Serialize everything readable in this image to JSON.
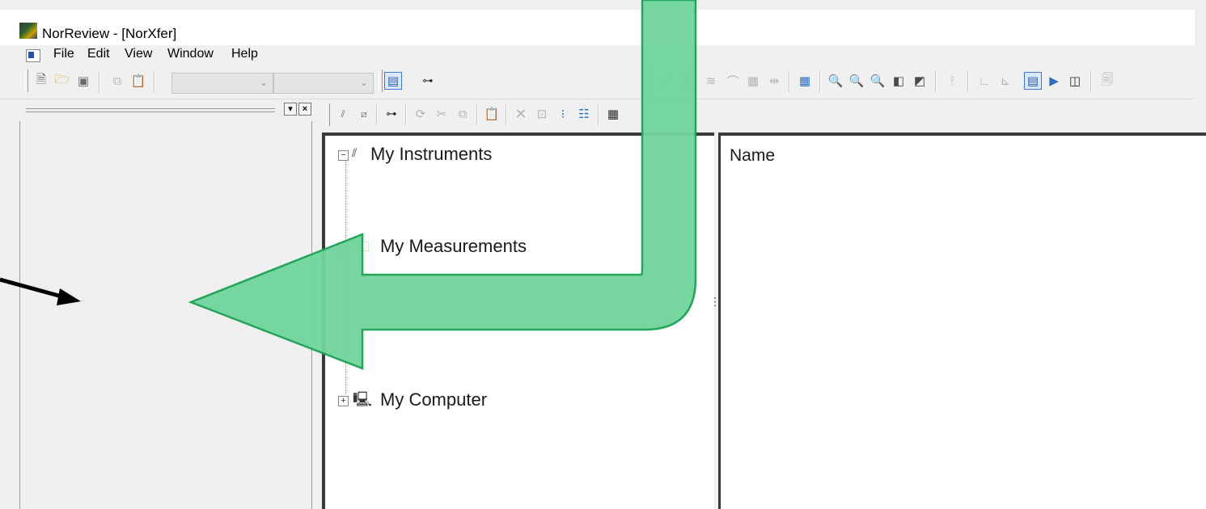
{
  "window": {
    "title": "NorReview - [NorXfer]"
  },
  "menu": {
    "items": [
      "File",
      "Edit",
      "View",
      "Window",
      "Help"
    ]
  },
  "toolbar": {
    "icons": [
      "new-icon",
      "open-icon",
      "save-icon",
      "copy-icon",
      "paste-icon",
      "combo-1",
      "combo-2",
      "window-icon",
      "tree-icon"
    ],
    "right_icons": [
      "line-graph-icon",
      "bar-graph-icon",
      "waterfall-icon",
      "curve-icon",
      "report-icon",
      "cursor-icon",
      "grid-icon",
      "zoom-in-icon",
      "zoom-out-icon",
      "zoom-fit-icon",
      "zoom-box-icon",
      "zoom-window-icon",
      "axis-icon",
      "axis-lin-icon",
      "axis-log-icon",
      "view-icon",
      "play-icon",
      "panel-icon",
      "properties-icon"
    ]
  },
  "tree": {
    "nodes": [
      {
        "label": "My Instruments",
        "expander": "−"
      },
      {
        "label": "My Measurements",
        "expander": "−"
      },
      {
        "label": "My Computer",
        "expander": "+"
      }
    ]
  },
  "list": {
    "column_name": "Name"
  },
  "annotations": {
    "black_arrow": "pointing-right",
    "green_arrow": "pointing-left",
    "colors": {
      "green_fill": "#72d59c",
      "green_stroke": "#1aa354",
      "black": "#000000"
    }
  }
}
